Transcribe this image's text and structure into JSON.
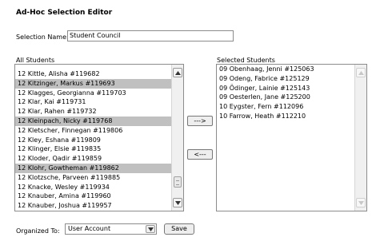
{
  "title": "Ad-Hoc Selection Editor",
  "selection_name": {
    "label": "Selection Name:",
    "value": "Student Council"
  },
  "all_students": {
    "label": "All Students",
    "items": [
      {
        "text": "12 Kittle, Alisha #119682",
        "selected": false
      },
      {
        "text": "12 Kitzinger, Markus #119693",
        "selected": true
      },
      {
        "text": "12 Klagges, Georgianna #119703",
        "selected": false
      },
      {
        "text": "12 Klar, Kai #119731",
        "selected": false
      },
      {
        "text": "12 Klar, Rahen #119732",
        "selected": false
      },
      {
        "text": "12 Kleinpach, Nicky #119768",
        "selected": true
      },
      {
        "text": "12 Kletscher, Finnegan #119806",
        "selected": false
      },
      {
        "text": "12 Kley, Eshana #119809",
        "selected": false
      },
      {
        "text": "12 Klinger, Elsie #119835",
        "selected": false
      },
      {
        "text": "12 Kloder, Qadir #119859",
        "selected": false
      },
      {
        "text": "12 Klohr, Gowtheman #119862",
        "selected": true
      },
      {
        "text": "12 Klotzsche, Parveen #119885",
        "selected": false
      },
      {
        "text": "12 Knacke, Wesley #119934",
        "selected": false
      },
      {
        "text": "12 Knauber, Amina #119960",
        "selected": false
      },
      {
        "text": "12 Knauber, Joshua #119957",
        "selected": false
      }
    ]
  },
  "selected_students": {
    "label": "Selected Students",
    "items": [
      "09 Obenhaag, Jenni #125063",
      "09 Odeng, Fabrice #125129",
      "09 Ödinger, Lainie #125143",
      "09 Oesterlen, Jane #125200",
      "10 Eygster, Fern #112096",
      "10 Farrow, Heath #112210"
    ]
  },
  "buttons": {
    "add": "--->",
    "remove": "<---",
    "save": "Save"
  },
  "organized_to": {
    "label": "Organized To:",
    "value": "User Account"
  }
}
